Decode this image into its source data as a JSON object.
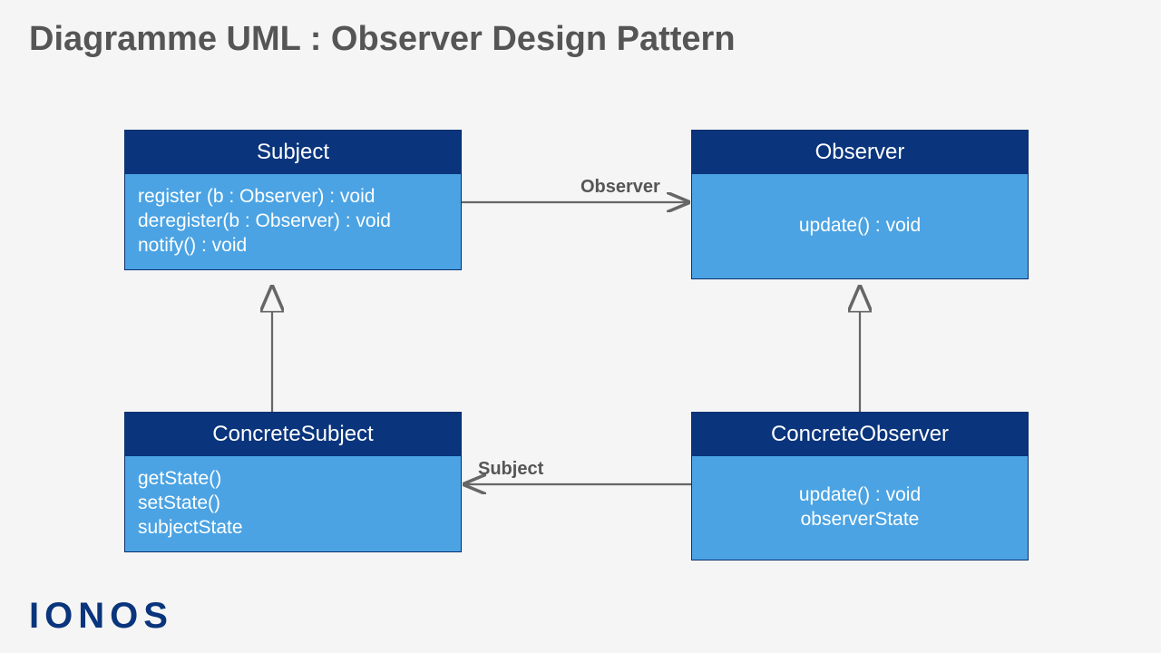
{
  "title": "Diagramme UML : Observer Design Pattern",
  "logo": "IONOS",
  "boxes": {
    "subject": {
      "name": "Subject",
      "methods": [
        "register (b : Observer) : void",
        "deregister(b : Observer) : void",
        "notify() : void"
      ]
    },
    "observer": {
      "name": "Observer",
      "methods": [
        "update() : void"
      ]
    },
    "concreteSubject": {
      "name": "ConcreteSubject",
      "methods": [
        "getState()",
        "setState()",
        "subjectState"
      ]
    },
    "concreteObserver": {
      "name": "ConcreteObserver",
      "methods": [
        "update() : void",
        "observerState"
      ]
    }
  },
  "labels": {
    "observer": "Observer",
    "subject": "Subject"
  },
  "colors": {
    "header": "#0a357d",
    "body": "#4ba3e3",
    "arrow": "#666"
  }
}
